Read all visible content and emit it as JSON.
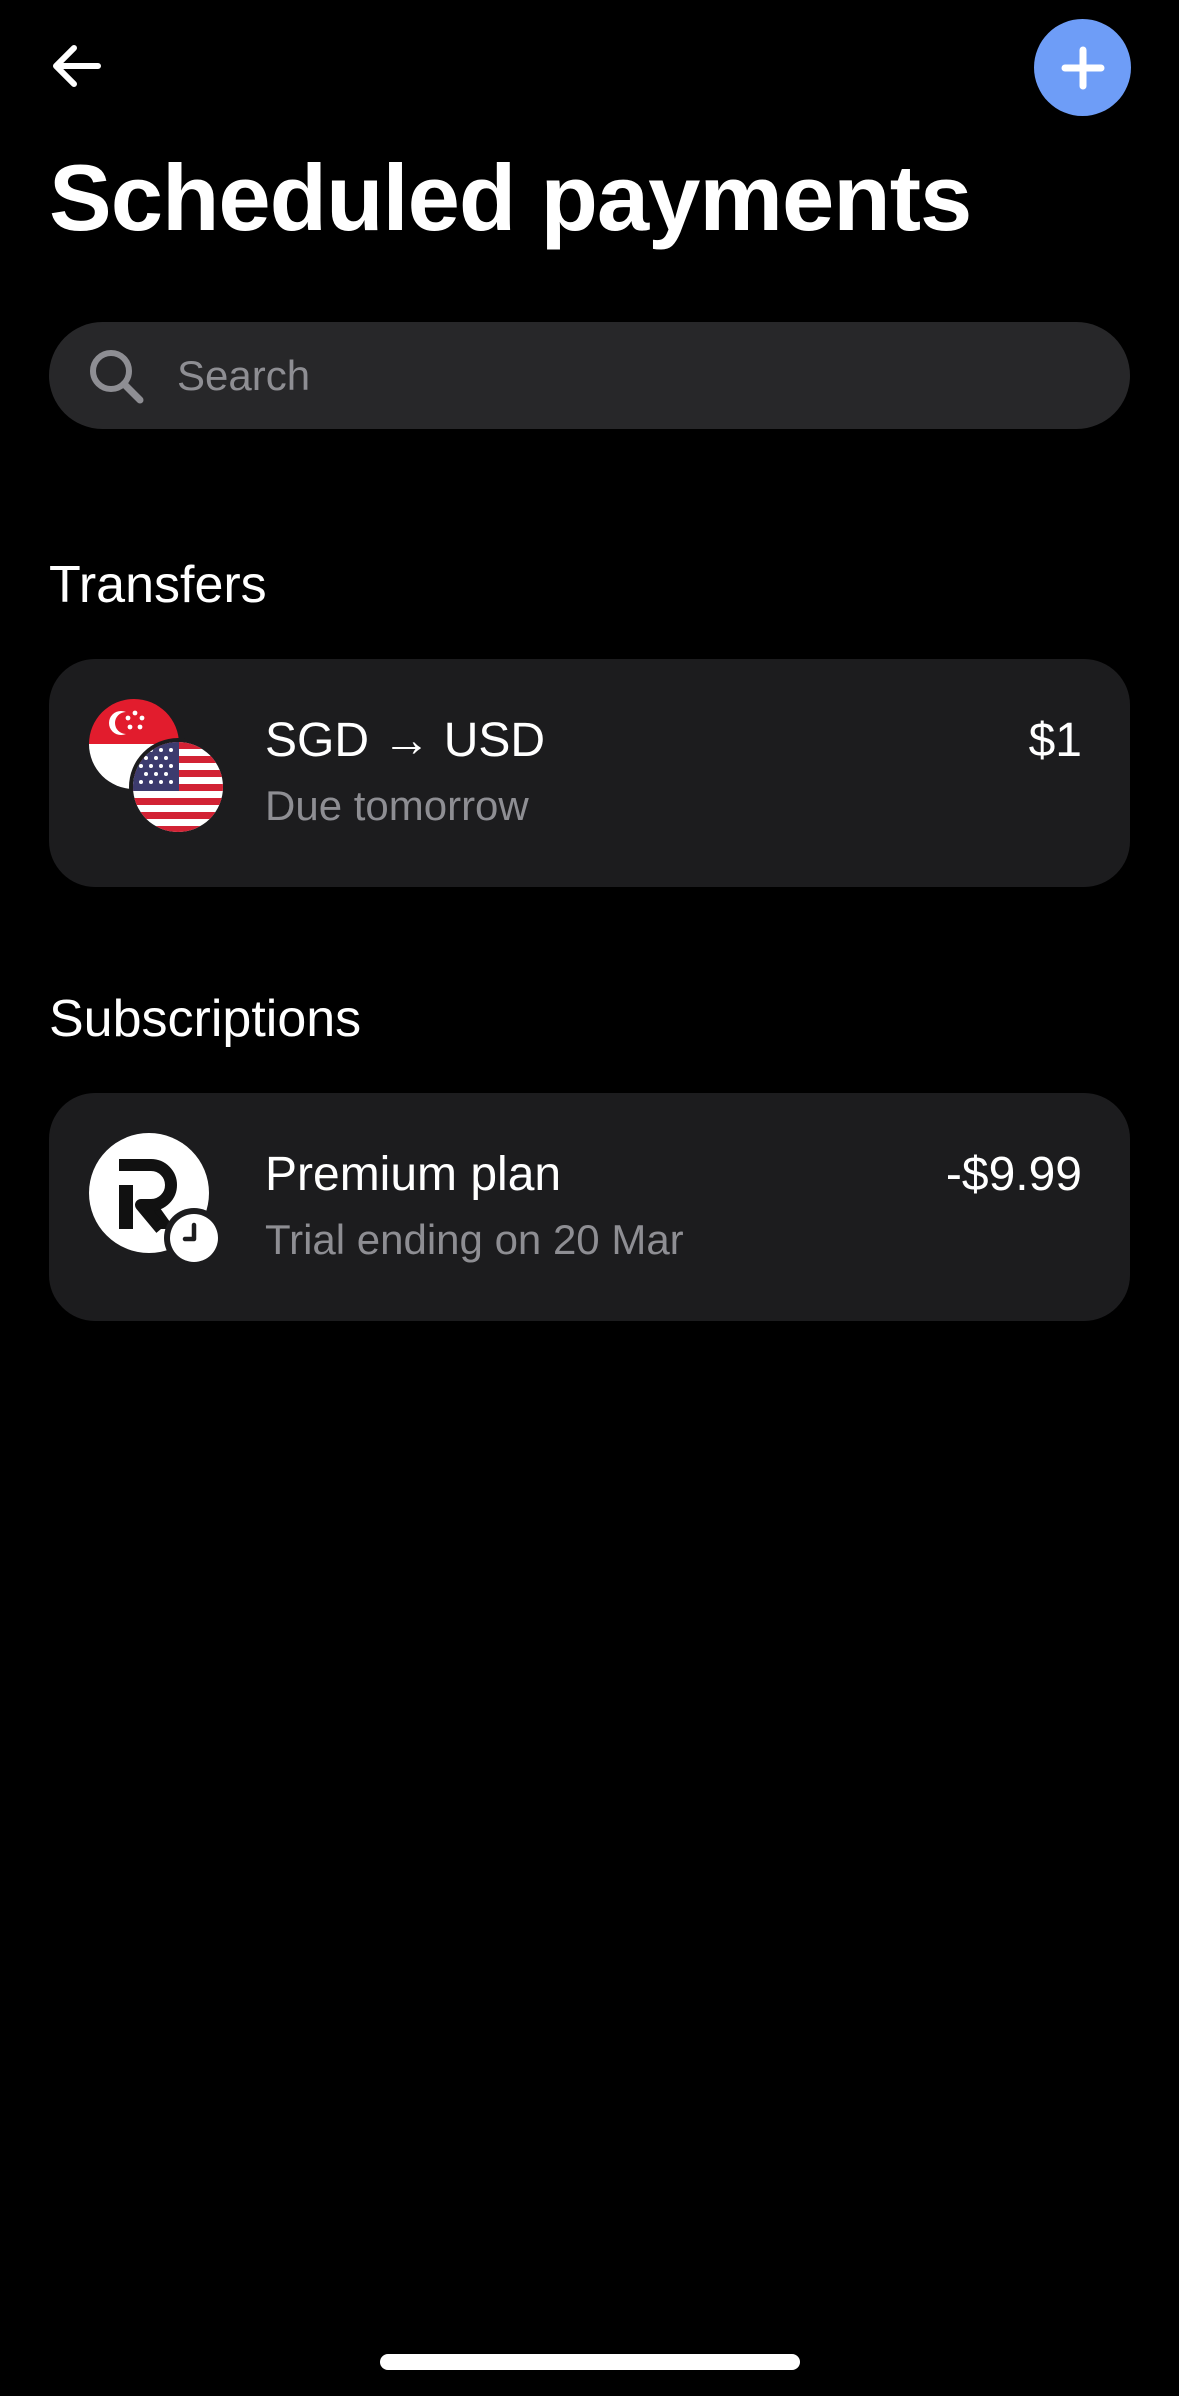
{
  "colors": {
    "background": "#000000",
    "accent": "#6e9df7",
    "card": "#1c1c1e",
    "search_bg": "#272729",
    "secondary_text": "#8e8e93"
  },
  "header": {
    "back_icon": "arrow-left-icon",
    "add_icon": "plus-icon",
    "title": "Scheduled payments"
  },
  "search": {
    "icon": "search-icon",
    "placeholder": "Search",
    "value": ""
  },
  "transfers": {
    "heading": "Transfers",
    "items": [
      {
        "title": "SGD → USD",
        "subtitle": "Due tomorrow",
        "amount": "$1",
        "from_flag": "singapore-flag-icon",
        "to_flag": "usa-flag-icon"
      }
    ]
  },
  "subscriptions": {
    "heading": "Subscriptions",
    "items": [
      {
        "title": "Premium plan",
        "subtitle": "Trial ending on 20 Mar",
        "amount": "-$9.99",
        "logo": "revolut-logo-icon",
        "badge_icon": "clock-icon"
      }
    ]
  }
}
